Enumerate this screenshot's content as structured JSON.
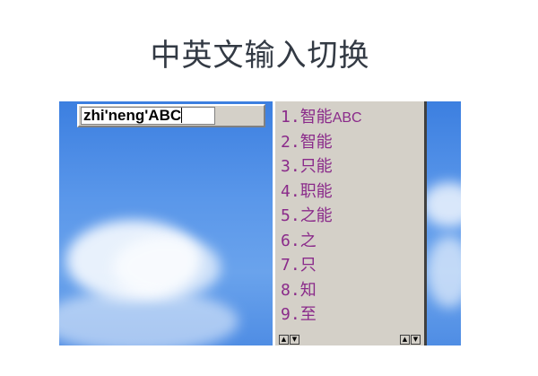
{
  "page": {
    "title": "中英文输入切换"
  },
  "ime": {
    "composition_text": "zhi'neng'ABC",
    "candidates": [
      {
        "num": "1.",
        "text": "智能",
        "extra": "ABC"
      },
      {
        "num": "2.",
        "text": "智能",
        "extra": ""
      },
      {
        "num": "3.",
        "text": "只能",
        "extra": ""
      },
      {
        "num": "4.",
        "text": "职能",
        "extra": ""
      },
      {
        "num": "5.",
        "text": "之能",
        "extra": ""
      },
      {
        "num": "6.",
        "text": "之",
        "extra": ""
      },
      {
        "num": "7.",
        "text": "只",
        "extra": ""
      },
      {
        "num": "8.",
        "text": "知",
        "extra": ""
      },
      {
        "num": "9.",
        "text": "至",
        "extra": ""
      }
    ],
    "scroll_icons": [
      "first-page-icon",
      "last-page-icon",
      "page-up-icon",
      "page-down-icon"
    ]
  },
  "colors": {
    "sky": "#5a97ea",
    "candidate_text": "#8a2a8a",
    "window_face": "#d4d0c8",
    "title_text": "#333a44"
  }
}
